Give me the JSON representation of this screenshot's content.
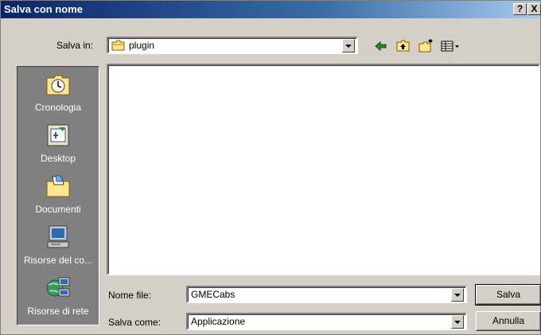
{
  "window": {
    "title": "Salva con nome",
    "help_label": "?",
    "close_label": "X"
  },
  "location": {
    "label": "Salva in:",
    "value": "plugin"
  },
  "toolbar": {
    "icons": [
      "back-arrow-icon",
      "up-folder-icon",
      "new-folder-icon",
      "view-menu-icon"
    ]
  },
  "places": [
    {
      "label": "Cronologia",
      "icon": "history-icon"
    },
    {
      "label": "Desktop",
      "icon": "desktop-icon"
    },
    {
      "label": "Documenti",
      "icon": "documents-folder-icon"
    },
    {
      "label": "Risorse del co...",
      "icon": "computer-icon"
    },
    {
      "label": "Risorse di rete",
      "icon": "network-icon"
    }
  ],
  "filename": {
    "label": "Nome file:",
    "value": "GMECabs"
  },
  "filetype": {
    "label": "Salva come:",
    "value": "Applicazione"
  },
  "buttons": {
    "save": "Salva",
    "cancel": "Annulla"
  },
  "colors": {
    "title_start": "#0a246a",
    "title_end": "#a6caf0",
    "dialog_face": "#d4d0c8",
    "places_bar": "#808080"
  }
}
